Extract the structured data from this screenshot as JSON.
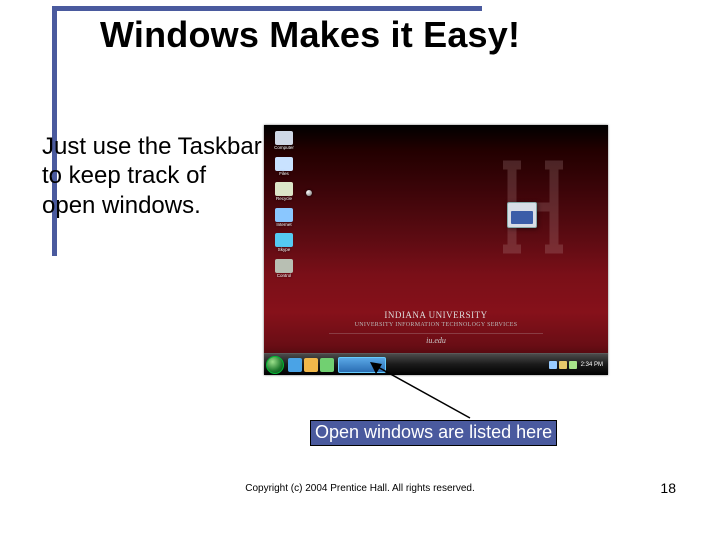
{
  "title": "Windows Makes it Easy!",
  "body_text": "Just use the Taskbar to keep track of open windows.",
  "callout": "Open windows are listed here",
  "copyright": "Copyright (c) 2004 Prentice Hall. All rights reserved.",
  "page_number": "18",
  "desktop": {
    "brand": "INDIANA UNIVERSITY",
    "subtitle": "UNIVERSITY INFORMATION TECHNOLOGY SERVICES",
    "url": "iu.edu",
    "icons": [
      {
        "label": "Computer",
        "color": "#cfd8e6"
      },
      {
        "label": "Files",
        "color": "#c9e2ff"
      },
      {
        "label": "Recycle",
        "color": "#dce6c8"
      },
      {
        "label": "Internet",
        "color": "#8ac7ff"
      },
      {
        "label": "Skype",
        "color": "#55caf2"
      },
      {
        "label": "Control",
        "color": "#b8bfb3"
      }
    ],
    "taskbar": {
      "quicklaunch_colors": [
        "#4aa3e6",
        "#f2b84a",
        "#71d071"
      ],
      "tray_time": "2:34 PM"
    }
  },
  "colors": {
    "accent": "#4a5a9e"
  }
}
